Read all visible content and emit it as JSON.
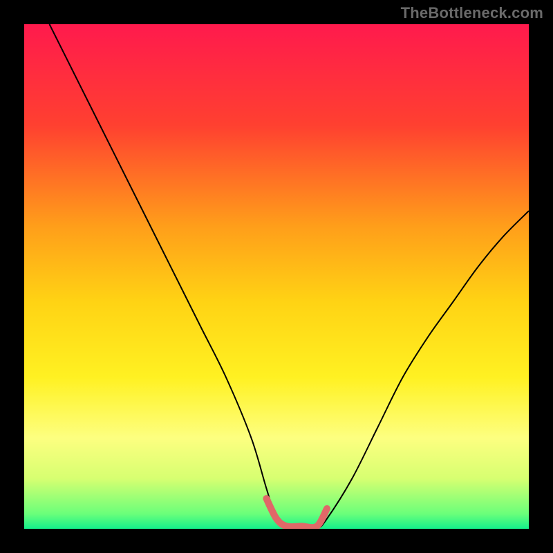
{
  "watermark": "TheBottleneck.com",
  "chart_data": {
    "type": "line",
    "title": "",
    "xlabel": "",
    "ylabel": "",
    "xlim": [
      0,
      100
    ],
    "ylim": [
      0,
      100
    ],
    "gradient": {
      "stops": [
        {
          "offset": 0,
          "color": "#ff1a4d"
        },
        {
          "offset": 20,
          "color": "#ff4030"
        },
        {
          "offset": 40,
          "color": "#ff9e1a"
        },
        {
          "offset": 55,
          "color": "#ffd314"
        },
        {
          "offset": 70,
          "color": "#fff122"
        },
        {
          "offset": 82,
          "color": "#fdff80"
        },
        {
          "offset": 90,
          "color": "#d7ff71"
        },
        {
          "offset": 97,
          "color": "#6bff7a"
        },
        {
          "offset": 100,
          "color": "#14f08b"
        }
      ]
    },
    "series": [
      {
        "name": "bottleneck-curve",
        "color": "#000000",
        "x": [
          5,
          10,
          15,
          20,
          25,
          30,
          35,
          40,
          45,
          48,
          50,
          52,
          55,
          58,
          60,
          65,
          70,
          75,
          80,
          85,
          90,
          95,
          100
        ],
        "y": [
          100,
          90,
          80,
          70,
          60,
          50,
          40,
          30,
          18,
          8,
          2,
          0,
          0,
          0,
          2,
          10,
          20,
          30,
          38,
          45,
          52,
          58,
          63
        ]
      },
      {
        "name": "optimal-zone",
        "color": "#e06868",
        "x": [
          48,
          50,
          52,
          55,
          58,
          60
        ],
        "y": [
          6,
          2,
          0.5,
          0.5,
          0.5,
          4
        ]
      }
    ]
  }
}
